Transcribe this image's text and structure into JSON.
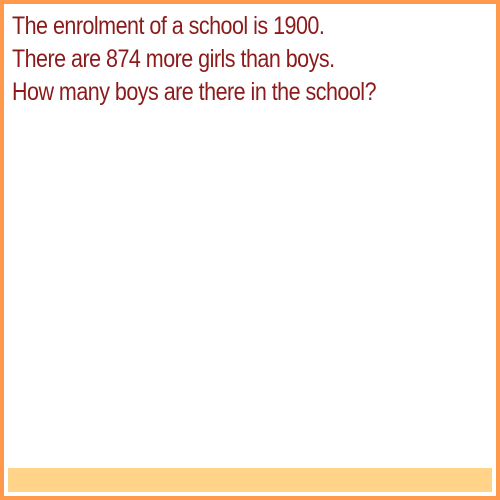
{
  "question": {
    "lines": [
      "The enrolment of a school is 1900.",
      "There are 874 more girls than boys.",
      "How many boys are there in the school?"
    ]
  },
  "colors": {
    "border": "#ff9a4d",
    "text": "#8b1a1a",
    "footer": "#ffd488"
  }
}
